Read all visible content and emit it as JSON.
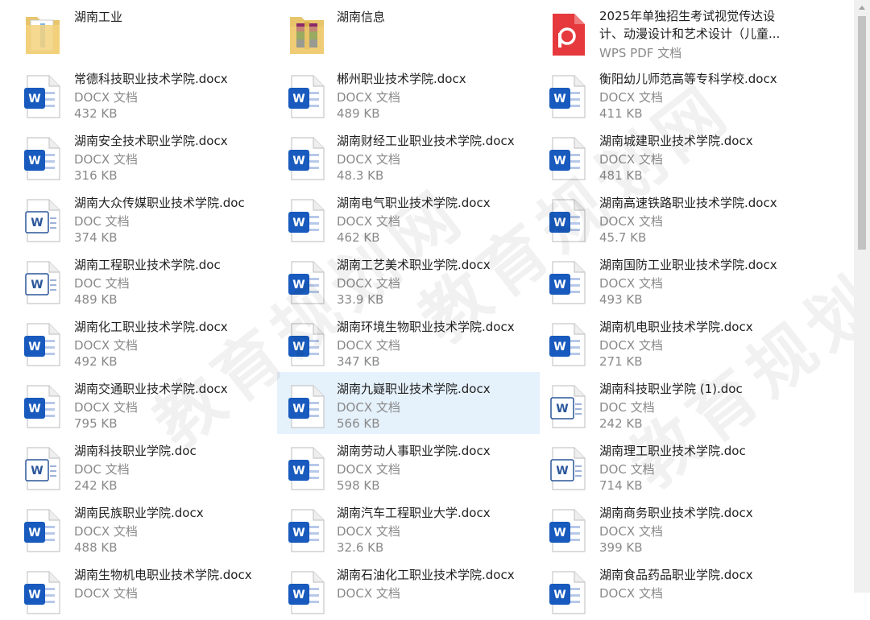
{
  "files": [
    {
      "name": "湖南工业",
      "kind": "folder-zip"
    },
    {
      "name": "湖南信息",
      "kind": "folder-rar"
    },
    {
      "name": "2025年单独招生考试视觉传达设计、动漫设计和艺术设计（儿童...",
      "type": "WPS PDF 文档",
      "kind": "pdf"
    },
    {
      "name": "常德科技职业技术学院.docx",
      "type": "DOCX 文档",
      "size": "432 KB",
      "kind": "docx"
    },
    {
      "name": "郴州职业技术学院.docx",
      "type": "DOCX 文档",
      "size": "489 KB",
      "kind": "docx"
    },
    {
      "name": "衡阳幼儿师范高等专科学校.docx",
      "type": "DOCX 文档",
      "size": "411 KB",
      "kind": "docx"
    },
    {
      "name": "湖南安全技术职业学院.docx",
      "type": "DOCX 文档",
      "size": "316 KB",
      "kind": "docx"
    },
    {
      "name": "湖南财经工业职业技术学院.docx",
      "type": "DOCX 文档",
      "size": "48.3 KB",
      "kind": "docx"
    },
    {
      "name": "湖南城建职业技术学院.docx",
      "type": "DOCX 文档",
      "size": "481 KB",
      "kind": "docx"
    },
    {
      "name": "湖南大众传媒职业技术学院.doc",
      "type": "DOC 文档",
      "size": "374 KB",
      "kind": "doc"
    },
    {
      "name": "湖南电气职业技术学院.docx",
      "type": "DOCX 文档",
      "size": "462 KB",
      "kind": "docx"
    },
    {
      "name": "湖南高速铁路职业技术学院.docx",
      "type": "DOCX 文档",
      "size": "45.7 KB",
      "kind": "docx"
    },
    {
      "name": "湖南工程职业技术学院.doc",
      "type": "DOC 文档",
      "size": "489 KB",
      "kind": "doc"
    },
    {
      "name": "湖南工艺美术职业学院.docx",
      "type": "DOCX 文档",
      "size": "33.9 KB",
      "kind": "docx"
    },
    {
      "name": "湖南国防工业职业技术学院.docx",
      "type": "DOCX 文档",
      "size": "493 KB",
      "kind": "docx"
    },
    {
      "name": "湖南化工职业技术学院.docx",
      "type": "DOCX 文档",
      "size": "492 KB",
      "kind": "docx"
    },
    {
      "name": "湖南环境生物职业技术学院.docx",
      "type": "DOCX 文档",
      "size": "347 KB",
      "kind": "docx"
    },
    {
      "name": "湖南机电职业技术学院.docx",
      "type": "DOCX 文档",
      "size": "271 KB",
      "kind": "docx"
    },
    {
      "name": "湖南交通职业技术学院.docx",
      "type": "DOCX 文档",
      "size": "795 KB",
      "kind": "docx"
    },
    {
      "name": "湖南九嶷职业技术学院.docx",
      "type": "DOCX 文档",
      "size": "566 KB",
      "kind": "docx",
      "selected": true
    },
    {
      "name": "湖南科技职业学院 (1).doc",
      "type": "DOC 文档",
      "size": "242 KB",
      "kind": "doc"
    },
    {
      "name": "湖南科技职业学院.doc",
      "type": "DOC 文档",
      "size": "242 KB",
      "kind": "doc"
    },
    {
      "name": "湖南劳动人事职业学院.docx",
      "type": "DOCX 文档",
      "size": "598 KB",
      "kind": "docx"
    },
    {
      "name": "湖南理工职业技术学院.doc",
      "type": "DOC 文档",
      "size": "714 KB",
      "kind": "doc"
    },
    {
      "name": "湖南民族职业学院.docx",
      "type": "DOCX 文档",
      "size": "488 KB",
      "kind": "docx"
    },
    {
      "name": "湖南汽车工程职业大学.docx",
      "type": "DOCX 文档",
      "size": "32.6 KB",
      "kind": "docx"
    },
    {
      "name": "湖南商务职业技术学院.docx",
      "type": "DOCX 文档",
      "size": "399 KB",
      "kind": "docx"
    },
    {
      "name": "湖南生物机电职业技术学院.docx",
      "type": "DOCX 文档",
      "size": "",
      "kind": "docx"
    },
    {
      "name": "湖南石油化工职业技术学院.docx",
      "type": "DOCX 文档",
      "size": "",
      "kind": "docx"
    },
    {
      "name": "湖南食品药品职业学院.docx",
      "type": "DOCX 文档",
      "size": "",
      "kind": "docx"
    }
  ],
  "watermark": "教育规划网",
  "colors": {
    "selected_bg": "#e5f1fb",
    "word_blue": "#185abd",
    "pdf_red": "#e5393d"
  }
}
